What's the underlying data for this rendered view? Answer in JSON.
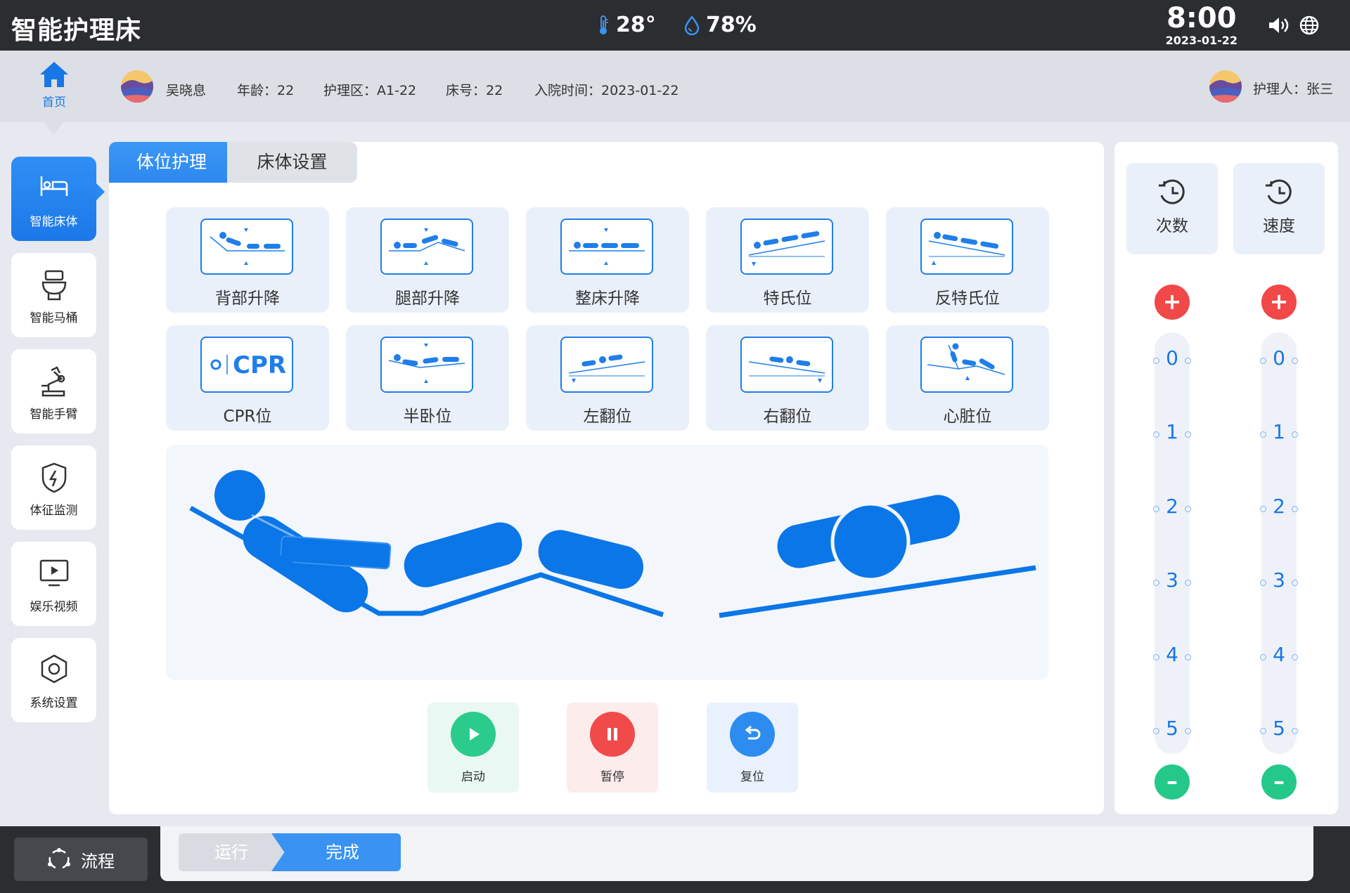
{
  "header": {
    "app_title": "智能护理床",
    "temperature": "28°",
    "humidity": "78%",
    "time": "8:00",
    "date": "2023-01-22"
  },
  "infobar": {
    "home_label": "首页",
    "patient_name": "吴晓息",
    "age": "年龄：22",
    "care_area": "护理区：A1-22",
    "bed_no": "床号：22",
    "admission": "入院时间：2023-01-22",
    "caregiver": "护理人：张三"
  },
  "sidebar": {
    "items": [
      {
        "label": "智能床体",
        "icon": "bed-icon",
        "active": true
      },
      {
        "label": "智能马桶",
        "icon": "toilet-icon"
      },
      {
        "label": "智能手臂",
        "icon": "robot-arm-icon"
      },
      {
        "label": "体征监测",
        "icon": "shield-bolt-icon"
      },
      {
        "label": "娱乐视频",
        "icon": "video-icon"
      },
      {
        "label": "系统设置",
        "icon": "hex-nut-icon"
      }
    ]
  },
  "tabs": [
    "体位护理",
    "床体设置"
  ],
  "positions": [
    "背部升降",
    "腿部升降",
    "整床升降",
    "特氏位",
    "反特氏位",
    "CPR位",
    "半卧位",
    "左翻位",
    "右翻位",
    "心脏位"
  ],
  "cpr_icon_text": "CPR",
  "controls": {
    "start": "启动",
    "pause": "暂停",
    "reset": "复位"
  },
  "params": {
    "count_label": "次数",
    "speed_label": "速度",
    "scale": [
      "0",
      "1",
      "2",
      "3",
      "4",
      "5"
    ]
  },
  "footer": {
    "flow_label": "流程",
    "step_run": "运行",
    "step_done": "完成"
  },
  "colors": {
    "primary": "#1877e6",
    "plus": "#f24848",
    "minus": "#24c98a",
    "dark_bar": "#2b2d31"
  }
}
